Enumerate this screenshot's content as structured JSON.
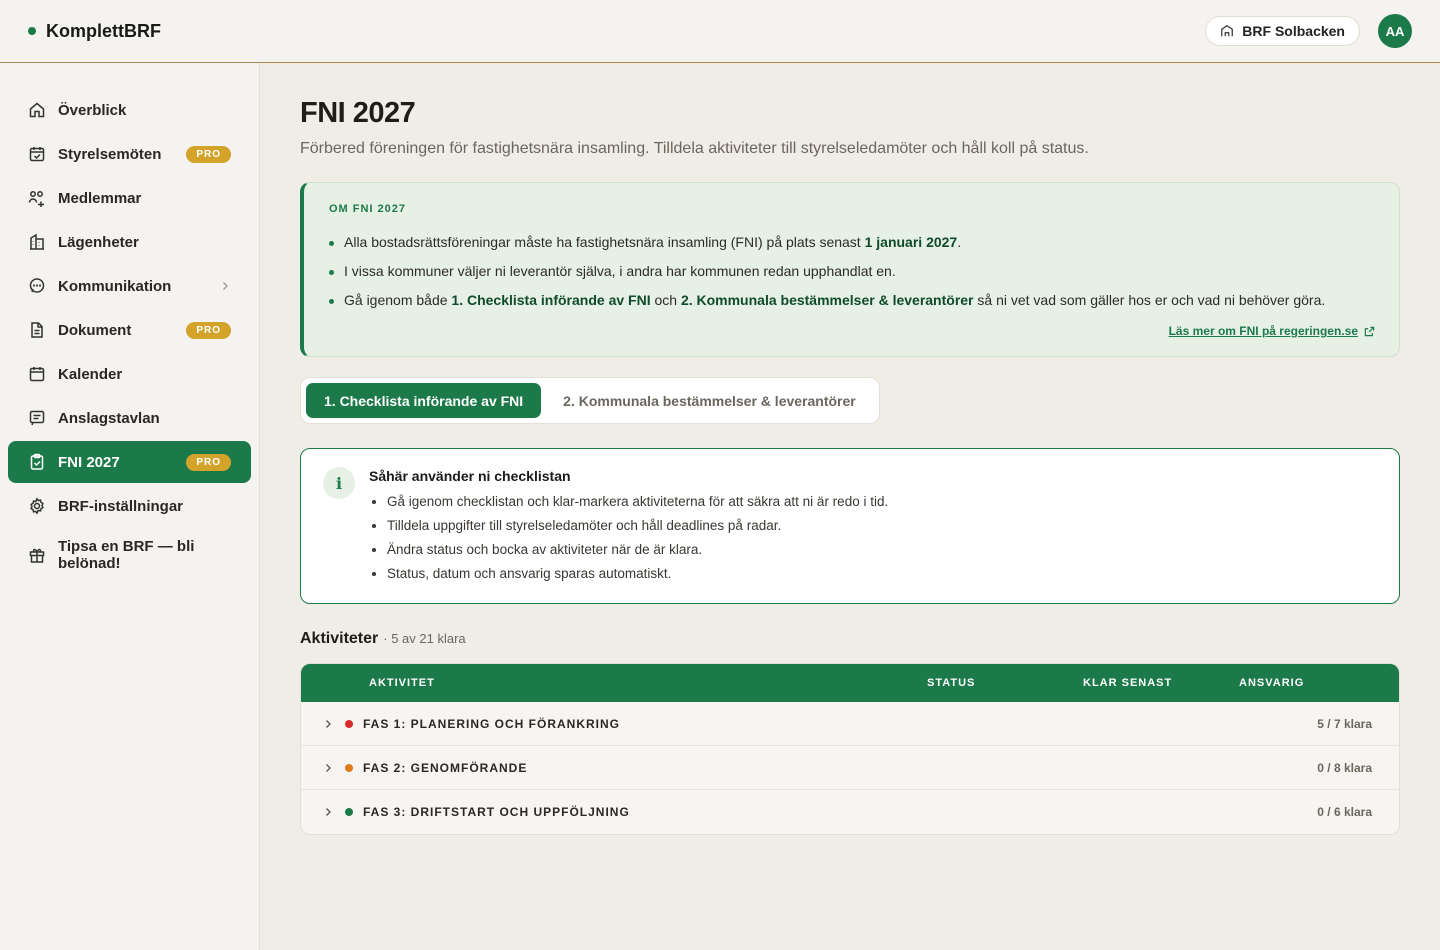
{
  "app": {
    "name": "KomplettBRF",
    "brf_name": "BRF Solbacken",
    "avatar_initials": "AA"
  },
  "colors": {
    "brand": "#1c7a4a",
    "pro": "#d4a42a",
    "phase1": "#d62b2b",
    "phase2": "#e07b1a",
    "phase3": "#1c7a4a"
  },
  "sidebar": {
    "items": [
      {
        "label": "Överblick",
        "icon": "home-icon"
      },
      {
        "label": "Styrelsemöten",
        "icon": "calendar-check-icon",
        "badge": "PRO"
      },
      {
        "label": "Medlemmar",
        "icon": "users-icon"
      },
      {
        "label": "Lägenheter",
        "icon": "building-icon"
      },
      {
        "label": "Kommunikation",
        "icon": "chat-icon"
      },
      {
        "label": "Dokument",
        "icon": "document-icon",
        "badge": "PRO"
      },
      {
        "label": "Kalender",
        "icon": "calendar-icon"
      },
      {
        "label": "Anslagstavlan",
        "icon": "board-icon"
      },
      {
        "label": "FNI 2027",
        "icon": "clipboard-check-icon",
        "badge": "PRO",
        "active": true
      },
      {
        "label": "BRF-inställningar",
        "icon": "gear-icon"
      },
      {
        "label": "Tipsa en BRF — bli belönad!",
        "icon": "gift-icon"
      }
    ]
  },
  "page": {
    "title": "FNI 2027",
    "subtitle": "Förbered föreningen för fastighetsnära insamling. Tilldela aktiviteter till styrelseledamöter och håll koll på status."
  },
  "about": {
    "kicker": "OM FNI 2027",
    "b1_pre": "Alla bostadsrättsföreningar måste ha fastighetsnära insamling (FNI) på plats senast ",
    "b1_bold": "1 januari 2027",
    "b1_post": ".",
    "b2": "I vissa kommuner väljer ni leverantör själva, i andra har kommunen redan upphandlat en.",
    "b3_pre": "Gå igenom både ",
    "b3_bold1": "1. Checklista införande av FNI",
    "b3_mid": " och ",
    "b3_bold2": "2. Kommunala bestämmelser & leverantörer",
    "b3_post": " så ni vet vad som gäller hos er och vad ni behöver göra.",
    "link": "Läs mer om FNI på regeringen.se"
  },
  "tabs": [
    {
      "label": "1. Checklista införande av FNI",
      "active": true
    },
    {
      "label": "2. Kommunala bestämmelser & leverantörer",
      "active": false
    }
  ],
  "info": {
    "badge": "i",
    "title": "Såhär använder ni checklistan",
    "items": [
      "Gå igenom checklistan och klar-markera aktiviteterna för att säkra att ni är redo i tid.",
      "Tilldela uppgifter till styrelseledamöter och håll deadlines på radar.",
      "Ändra status och bocka av aktiviteter när de är klara.",
      "Status, datum och ansvarig sparas automatiskt."
    ]
  },
  "activities": {
    "title": "Aktiviteter",
    "count": "· 5 av 21 klara",
    "columns": [
      "AKTIVITET",
      "STATUS",
      "KLAR SENAST",
      "ANSVARIG"
    ],
    "phases": [
      {
        "label": "FAS 1: PLANERING OCH FÖRANKRING",
        "count": "5 / 7 klara"
      },
      {
        "label": "FAS 2: GENOMFÖRANDE",
        "count": "0 / 8 klara"
      },
      {
        "label": "FAS 3: DRIFTSTART OCH UPPFÖLJNING",
        "count": "0 / 6 klara"
      }
    ]
  }
}
